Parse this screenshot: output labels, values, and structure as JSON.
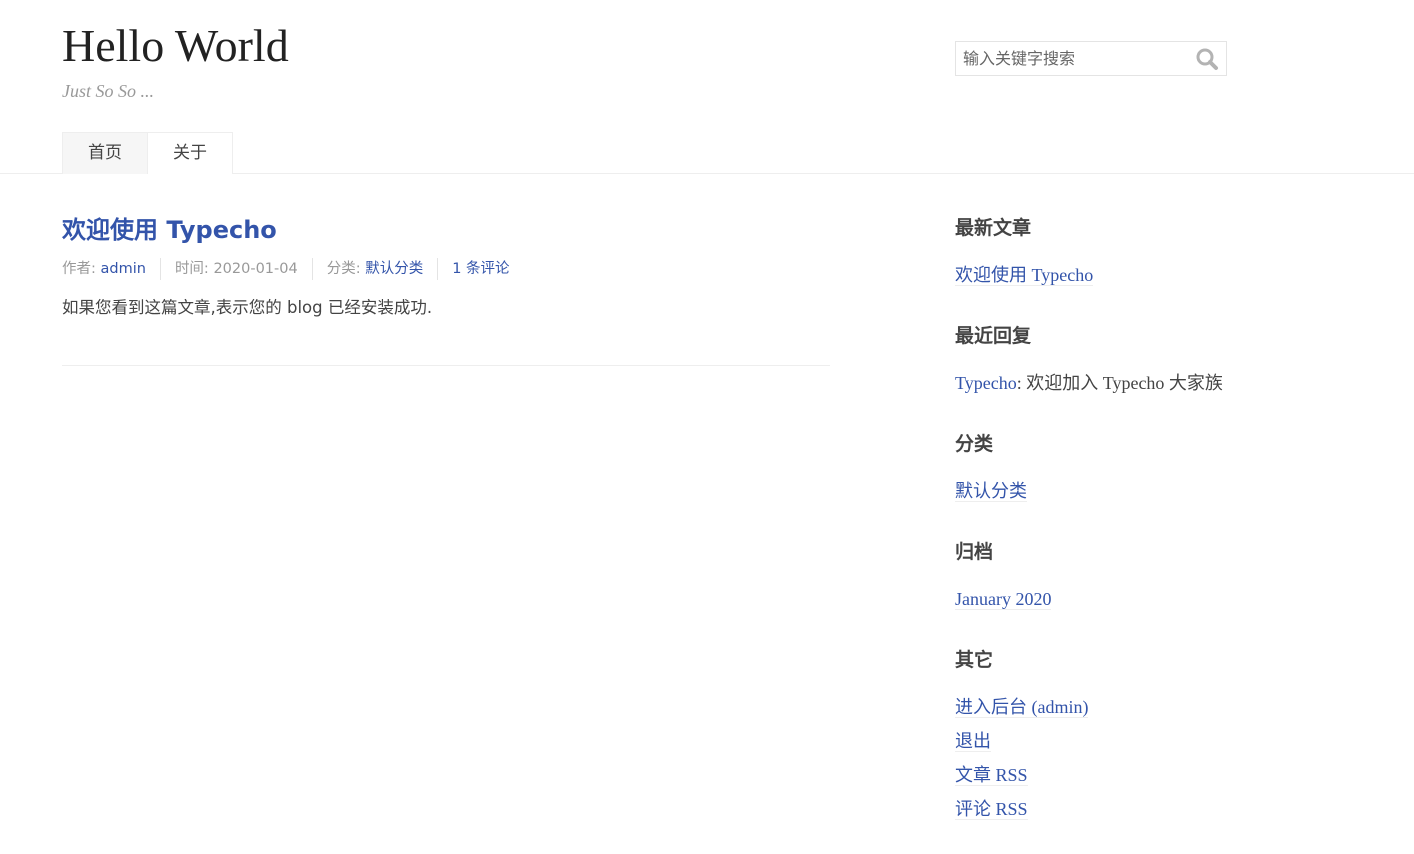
{
  "site": {
    "title": "Hello World",
    "description": "Just So So ..."
  },
  "search": {
    "placeholder": "输入关键字搜索",
    "icon": "search-icon"
  },
  "nav": {
    "items": [
      {
        "label": "首页",
        "current": true
      },
      {
        "label": "关于",
        "current": false
      }
    ]
  },
  "post": {
    "title": "欢迎使用 Typecho",
    "meta": {
      "author_label": "作者: ",
      "author": "admin",
      "time_label": "时间: ",
      "time": "2020-01-04",
      "category_label": "分类: ",
      "category": "默认分类",
      "comments": "1 条评论"
    },
    "content": "如果您看到这篇文章,表示您的 blog 已经安装成功."
  },
  "sidebar": {
    "recent_posts": {
      "title": "最新文章",
      "items": [
        "欢迎使用 Typecho"
      ]
    },
    "recent_comments": {
      "title": "最近回复",
      "items": [
        {
          "author": "Typecho",
          "text": ": 欢迎加入 Typecho 大家族"
        }
      ]
    },
    "categories": {
      "title": "分类",
      "items": [
        "默认分类"
      ]
    },
    "archives": {
      "title": "归档",
      "items": [
        "January 2020"
      ]
    },
    "misc": {
      "title": "其它",
      "items": [
        "进入后台 (admin)",
        "退出",
        "文章 RSS",
        "评论 RSS"
      ]
    }
  },
  "colors": {
    "link": "#3354AA",
    "text": "#444444",
    "muted": "#999999",
    "border": "#eeeeee"
  }
}
